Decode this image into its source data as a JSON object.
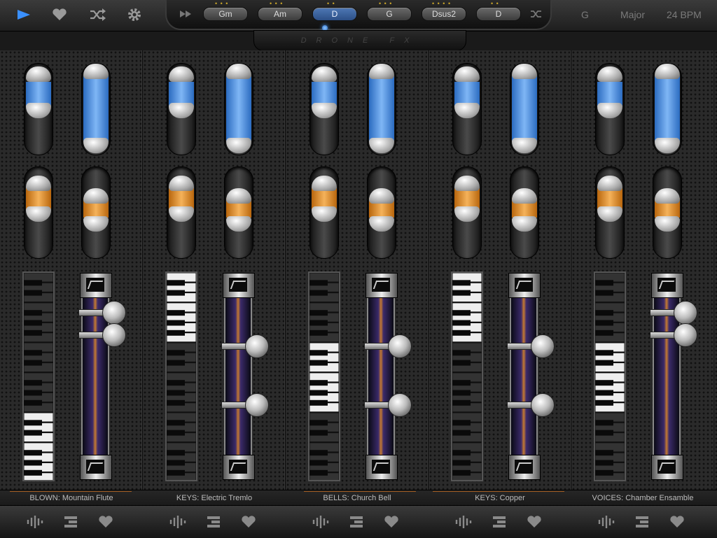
{
  "topbar": {
    "chords": [
      {
        "label": "Gm",
        "dots": "• • •",
        "selected": false
      },
      {
        "label": "Am",
        "dots": "• • •",
        "selected": false
      },
      {
        "label": "D",
        "dots": "• •",
        "selected": true
      },
      {
        "label": "G",
        "dots": "• • •",
        "selected": false
      },
      {
        "label": "Dsus2",
        "dots": "• • • •",
        "selected": false
      },
      {
        "label": "D",
        "dots": "• •",
        "selected": false
      }
    ],
    "key": "G",
    "scale": "Major",
    "tempo": "24 BPM",
    "fx_label": "DRONE FX"
  },
  "channels": [
    {
      "name": "BLOWN: Mountain Flute"
    },
    {
      "name": "KEYS: Electric Tremlo"
    },
    {
      "name": "BELLS: Church Bell"
    },
    {
      "name": "KEYS: Copper"
    },
    {
      "name": "VOICES: Chamber Ensamble"
    }
  ],
  "colors": {
    "accent_blue": "#3c7fd6",
    "accent_orange": "#e08a26",
    "label_text": "#bdbdbd"
  }
}
